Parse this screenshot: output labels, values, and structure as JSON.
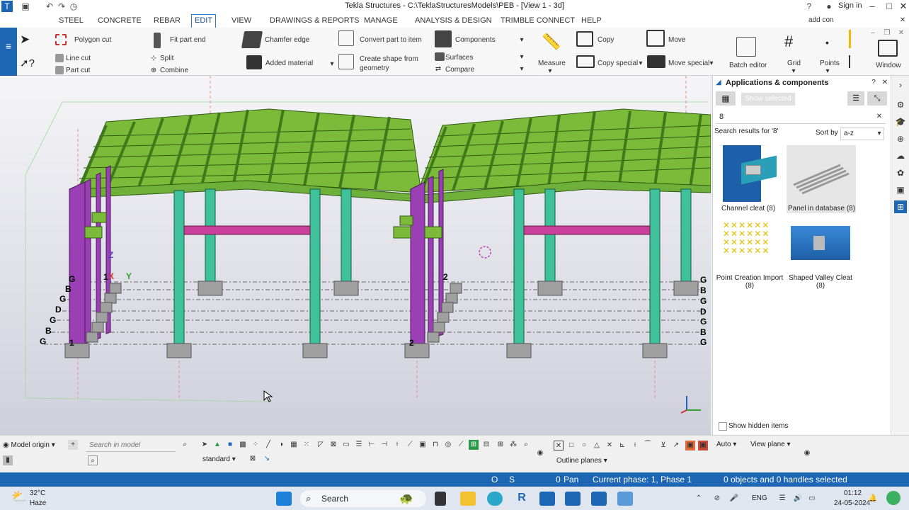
{
  "window": {
    "title": "Tekla Structures - C:\\TeklaStructuresModels\\PEB - [View 1 - 3d]",
    "sign_in": "Sign in",
    "search_value": "add con"
  },
  "menu": {
    "tabs": [
      "STEEL",
      "CONCRETE",
      "REBAR",
      "EDIT",
      "VIEW",
      "DRAWINGS & REPORTS",
      "MANAGE",
      "ANALYSIS & DESIGN",
      "TRIMBLE CONNECT",
      "HELP"
    ],
    "active": "EDIT"
  },
  "ribbon": {
    "polygon_cut": "Polygon cut",
    "line_cut": "Line cut",
    "part_cut": "Part cut",
    "fit_part_end": "Fit part end",
    "split": "Split",
    "combine": "Combine",
    "chamfer_edge": "Chamfer edge",
    "added_material": "Added material",
    "convert_part": "Convert part to item",
    "create_shape_1": "Create shape from",
    "create_shape_2": "geometry",
    "components": "Components",
    "surfaces": "Surfaces",
    "compare": "Compare",
    "measure": "Measure",
    "copy": "Copy",
    "copy_special": "Copy special",
    "move": "Move",
    "move_special": "Move special",
    "batch_editor": "Batch editor",
    "grid": "Grid",
    "points": "Points",
    "window": "Window"
  },
  "grid_labels": {
    "left": [
      "G",
      "B",
      "G",
      "D",
      "G",
      "B",
      "G"
    ],
    "right": [
      "G",
      "B",
      "G",
      "D",
      "G",
      "B",
      "G"
    ],
    "axis_1": "1",
    "axis_2": "2",
    "z": "Z",
    "x": "X",
    "y": "Y"
  },
  "panel": {
    "title": "Applications & components",
    "show_selected": "Show selected",
    "search_value": "8",
    "results_text": "Search results for '8'",
    "sort_by": "Sort by",
    "sort_value": "a-z",
    "items": [
      {
        "name": "Channel cleat (8)"
      },
      {
        "name": "Panel in database (8)"
      },
      {
        "name": "Point Creation Import (8)"
      },
      {
        "name": "Shaped Valley Cleat (8)"
      }
    ],
    "show_hidden": "Show hidden items"
  },
  "bottom": {
    "model_origin": "Model origin",
    "search_model_placeholder": "Search in model",
    "standard": "standard",
    "auto": "Auto",
    "view_plane": "View plane",
    "outline_planes": "Outline planes"
  },
  "status": {
    "o": "O",
    "s": "S",
    "zero": "0",
    "pan": "Pan",
    "phase": "Current phase: 1, Phase 1",
    "selection": "0 objects and 0 handles selected"
  },
  "taskbar": {
    "temperature": "32°C",
    "weather": "Haze",
    "search": "Search",
    "lang": "ENG",
    "time": "01:12",
    "date": "24-05-2024"
  },
  "colors": {
    "accent": "#1d66b3",
    "roof_green": "#7cba3a",
    "column_teal": "#3fc29a",
    "column_purple": "#9b3fb5",
    "beam_magenta": "#c8409a"
  }
}
